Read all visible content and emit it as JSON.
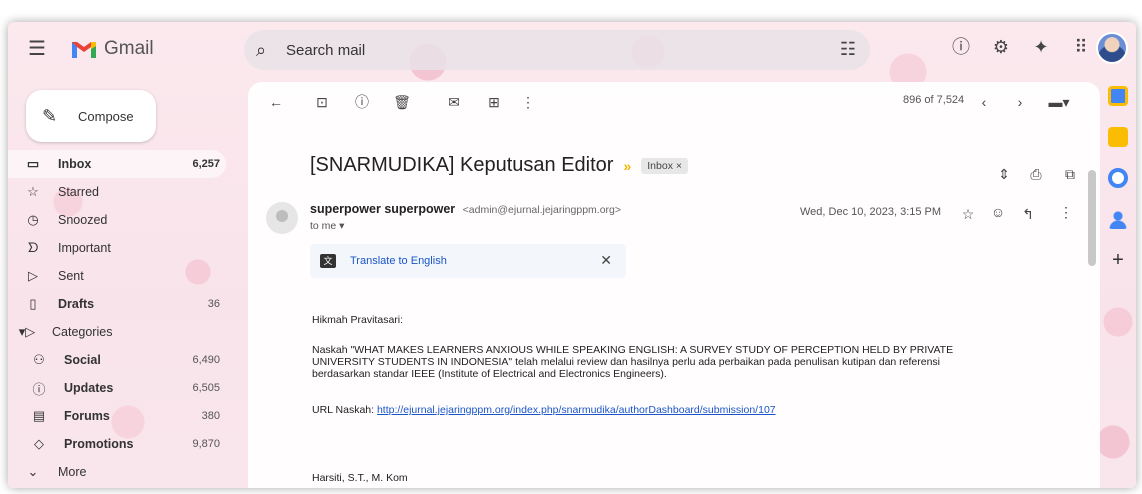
{
  "app": {
    "name": "Gmail"
  },
  "search": {
    "placeholder": "Search mail"
  },
  "compose": {
    "label": "Compose"
  },
  "nav": {
    "items": [
      {
        "label": "Inbox",
        "count": "6,257"
      },
      {
        "label": "Starred",
        "count": ""
      },
      {
        "label": "Snoozed",
        "count": ""
      },
      {
        "label": "Important",
        "count": ""
      },
      {
        "label": "Sent",
        "count": ""
      },
      {
        "label": "Drafts",
        "count": "36"
      },
      {
        "label": "Categories",
        "count": ""
      },
      {
        "label": "Social",
        "count": "6,490"
      },
      {
        "label": "Updates",
        "count": "6,505"
      },
      {
        "label": "Forums",
        "count": "380"
      },
      {
        "label": "Promotions",
        "count": "9,870"
      },
      {
        "label": "More",
        "count": ""
      }
    ]
  },
  "toolbar": {
    "pager": "896 of 7,524"
  },
  "email": {
    "subject": "[SNARMUDIKA] Keputusan Editor",
    "label_chip": "Inbox ×",
    "sender_name": "superpower superpower",
    "sender_email": "<admin@ejurnal.jejaringppm.org>",
    "to": "to me ▾",
    "date": "Wed, Dec 10, 2023, 3:15 PM",
    "translate_label": "Translate to English",
    "greeting": "Hikmah Pravitasari:",
    "para_line1": "Naskah \"WHAT MAKES LEARNERS ANXIOUS WHILE SPEAKING ENGLISH: A SURVEY STUDY OF PERCEPTION HELD BY PRIVATE",
    "para_line2": "UNIVERSITY STUDENTS IN INDONESIA\" telah melalui review dan hasilnya perlu ada perbaikan pada penulisan kutipan dan referensi",
    "para_line3": "berdasarkan standar IEEE (Institute of Electrical and Electronics Engineers).",
    "url_label": "URL Naskah: ",
    "url": "http://ejurnal.jejaringppm.org/index.php/snarmudika/authorDashboard/submission/107",
    "signature": "Harsiti, S.T., M. Kom"
  },
  "colors": {
    "accent_link": "#1a56c9",
    "background": "#f8e3ea"
  }
}
